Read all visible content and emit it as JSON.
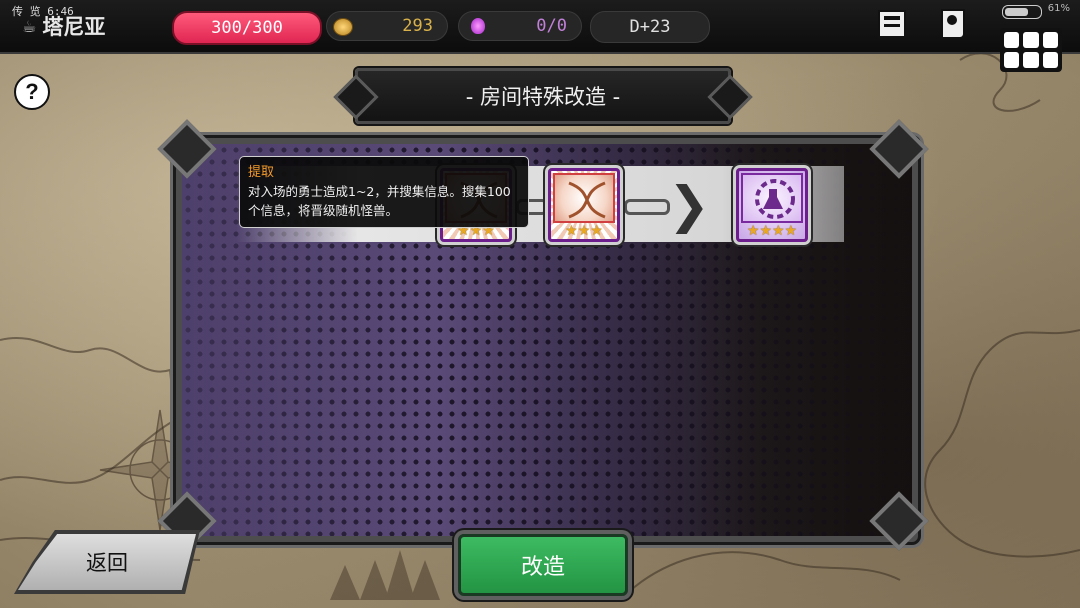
{
  "system_status": {
    "carrier": "传 览",
    "time": "6:46",
    "battery_percent": "61%"
  },
  "header": {
    "location": "塔尼亚",
    "hp": "300/300",
    "gold": "293",
    "mana": "0/0",
    "day": "D+23"
  },
  "help_label": "?",
  "title": "- 房间特殊改造 -",
  "tooltip": {
    "title": "提取",
    "description": "对入场的勇士造成1~2，并搜集信息。搜集100个信息，将晋级随机怪兽。"
  },
  "cards": [
    {
      "name": "dna-extract",
      "icon": "dna-icon",
      "stars": 3
    },
    {
      "name": "dna-extract",
      "icon": "dna-icon",
      "stars": 3
    },
    {
      "name": "lab-upgrade",
      "icon": "flask-gear-icon",
      "stars": 4
    }
  ],
  "buttons": {
    "back": "返回",
    "modify": "改造"
  },
  "colors": {
    "hp_pill": "#e02653",
    "gold": "#d9b14a",
    "mana": "#c080d8",
    "card_border": "#6c1e8c",
    "modify_button": "#239443",
    "tooltip_title": "#f39a2a"
  }
}
